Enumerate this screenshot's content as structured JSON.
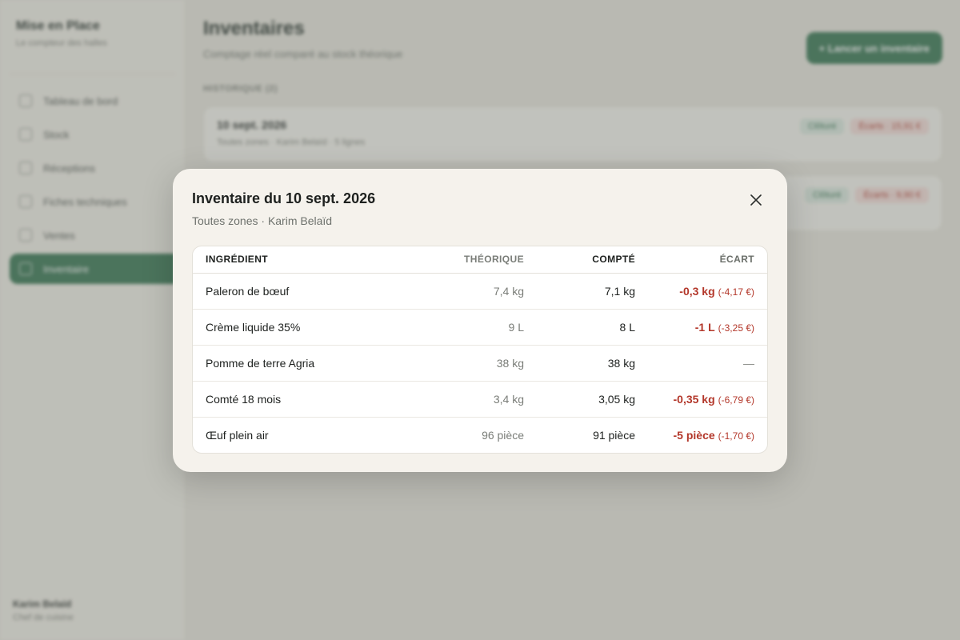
{
  "sidebar": {
    "brand": "Mise en Place",
    "tagline": "Le compteur des halles",
    "items": [
      {
        "label": "Tableau de bord",
        "active": false
      },
      {
        "label": "Stock",
        "active": false
      },
      {
        "label": "Réceptions",
        "active": false
      },
      {
        "label": "Fiches techniques",
        "active": false
      },
      {
        "label": "Ventes",
        "active": false
      },
      {
        "label": "Inventaire",
        "active": true
      }
    ],
    "user_name": "Karim Belaïd",
    "user_role": "Chef de cuisine"
  },
  "page": {
    "title": "Inventaires",
    "subtitle": "Comptage réel comparé au stock théorique",
    "new_button": "+ Lancer un inventaire",
    "history_label": "HISTORIQUE (2)",
    "history": [
      {
        "title": "10 sept. 2026",
        "meta": "Toutes zones · Karim Belaïd · 5 lignes",
        "status": "Clôturé",
        "gap": "Écarts · 15,91 €"
      },
      {
        "title": "",
        "meta": "",
        "status": "Clôturé",
        "gap": "Écarts · 9,90 €"
      }
    ]
  },
  "modal": {
    "title": "Inventaire du 10 sept. 2026",
    "subtitle": "Toutes zones · Karim Belaïd",
    "columns": {
      "ingredient": "Ingrédient",
      "theorique": "Théorique",
      "compte": "Compté",
      "ecart": "Écart"
    },
    "rows": [
      {
        "name": "Paleron de bœuf",
        "theorique": "7,4 kg",
        "compte": "7,1 kg",
        "ecart": "-0,3 kg",
        "ecart_cost": "(-4,17 €)"
      },
      {
        "name": "Crème liquide 35%",
        "theorique": "9 L",
        "compte": "8 L",
        "ecart": "-1 L",
        "ecart_cost": "(-3,25 €)"
      },
      {
        "name": "Pomme de terre Agria",
        "theorique": "38 kg",
        "compte": "38 kg",
        "ecart": "—",
        "ecart_cost": ""
      },
      {
        "name": "Comté 18 mois",
        "theorique": "3,4 kg",
        "compte": "3,05 kg",
        "ecart": "-0,35 kg",
        "ecart_cost": "(-6,79 €)"
      },
      {
        "name": "Œuf plein air",
        "theorique": "96 pièce",
        "compte": "91 pièce",
        "ecart": "-5 pièce",
        "ecart_cost": "(-1,70 €)"
      }
    ]
  },
  "colors": {
    "accent": "#2c6e49",
    "negative": "#b3372a",
    "modal_bg": "#f5f2ec"
  }
}
